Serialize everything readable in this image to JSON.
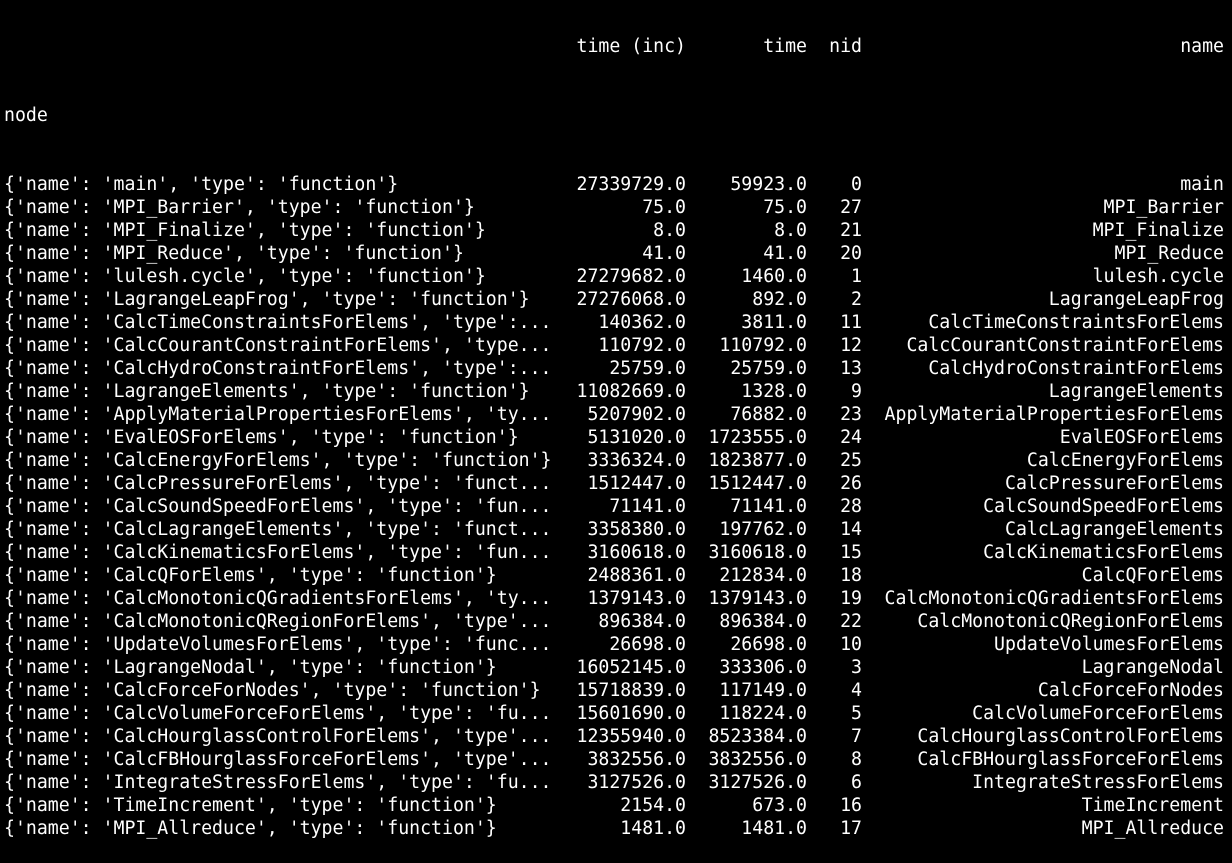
{
  "header": {
    "time_inc": "time (inc)",
    "time": "time",
    "nid": "nid",
    "name": "name",
    "index_label": "node"
  },
  "rows": [
    {
      "node": "{'name': 'main', 'type': 'function'}",
      "time_inc": "27339729.0",
      "time": "59923.0",
      "nid": "0",
      "name": "main"
    },
    {
      "node": "{'name': 'MPI_Barrier', 'type': 'function'}",
      "time_inc": "75.0",
      "time": "75.0",
      "nid": "27",
      "name": "MPI_Barrier"
    },
    {
      "node": "{'name': 'MPI_Finalize', 'type': 'function'}",
      "time_inc": "8.0",
      "time": "8.0",
      "nid": "21",
      "name": "MPI_Finalize"
    },
    {
      "node": "{'name': 'MPI_Reduce', 'type': 'function'}",
      "time_inc": "41.0",
      "time": "41.0",
      "nid": "20",
      "name": "MPI_Reduce"
    },
    {
      "node": "{'name': 'lulesh.cycle', 'type': 'function'}",
      "time_inc": "27279682.0",
      "time": "1460.0",
      "nid": "1",
      "name": "lulesh.cycle"
    },
    {
      "node": "{'name': 'LagrangeLeapFrog', 'type': 'function'}",
      "time_inc": "27276068.0",
      "time": "892.0",
      "nid": "2",
      "name": "LagrangeLeapFrog"
    },
    {
      "node": "{'name': 'CalcTimeConstraintsForElems', 'type':...",
      "time_inc": "140362.0",
      "time": "3811.0",
      "nid": "11",
      "name": "CalcTimeConstraintsForElems"
    },
    {
      "node": "{'name': 'CalcCourantConstraintForElems', 'type...",
      "time_inc": "110792.0",
      "time": "110792.0",
      "nid": "12",
      "name": "CalcCourantConstraintForElems"
    },
    {
      "node": "{'name': 'CalcHydroConstraintForElems', 'type':...",
      "time_inc": "25759.0",
      "time": "25759.0",
      "nid": "13",
      "name": "CalcHydroConstraintForElems"
    },
    {
      "node": "{'name': 'LagrangeElements', 'type': 'function'}",
      "time_inc": "11082669.0",
      "time": "1328.0",
      "nid": "9",
      "name": "LagrangeElements"
    },
    {
      "node": "{'name': 'ApplyMaterialPropertiesForElems', 'ty...",
      "time_inc": "5207902.0",
      "time": "76882.0",
      "nid": "23",
      "name": "ApplyMaterialPropertiesForElems"
    },
    {
      "node": "{'name': 'EvalEOSForElems', 'type': 'function'}",
      "time_inc": "5131020.0",
      "time": "1723555.0",
      "nid": "24",
      "name": "EvalEOSForElems"
    },
    {
      "node": "{'name': 'CalcEnergyForElems', 'type': 'function'}",
      "time_inc": "3336324.0",
      "time": "1823877.0",
      "nid": "25",
      "name": "CalcEnergyForElems"
    },
    {
      "node": "{'name': 'CalcPressureForElems', 'type': 'funct...",
      "time_inc": "1512447.0",
      "time": "1512447.0",
      "nid": "26",
      "name": "CalcPressureForElems"
    },
    {
      "node": "{'name': 'CalcSoundSpeedForElems', 'type': 'fun...",
      "time_inc": "71141.0",
      "time": "71141.0",
      "nid": "28",
      "name": "CalcSoundSpeedForElems"
    },
    {
      "node": "{'name': 'CalcLagrangeElements', 'type': 'funct...",
      "time_inc": "3358380.0",
      "time": "197762.0",
      "nid": "14",
      "name": "CalcLagrangeElements"
    },
    {
      "node": "{'name': 'CalcKinematicsForElems', 'type': 'fun...",
      "time_inc": "3160618.0",
      "time": "3160618.0",
      "nid": "15",
      "name": "CalcKinematicsForElems"
    },
    {
      "node": "{'name': 'CalcQForElems', 'type': 'function'}",
      "time_inc": "2488361.0",
      "time": "212834.0",
      "nid": "18",
      "name": "CalcQForElems"
    },
    {
      "node": "{'name': 'CalcMonotonicQGradientsForElems', 'ty...",
      "time_inc": "1379143.0",
      "time": "1379143.0",
      "nid": "19",
      "name": "CalcMonotonicQGradientsForElems"
    },
    {
      "node": "{'name': 'CalcMonotonicQRegionForElems', 'type'...",
      "time_inc": "896384.0",
      "time": "896384.0",
      "nid": "22",
      "name": "CalcMonotonicQRegionForElems"
    },
    {
      "node": "{'name': 'UpdateVolumesForElems', 'type': 'func...",
      "time_inc": "26698.0",
      "time": "26698.0",
      "nid": "10",
      "name": "UpdateVolumesForElems"
    },
    {
      "node": "{'name': 'LagrangeNodal', 'type': 'function'}",
      "time_inc": "16052145.0",
      "time": "333306.0",
      "nid": "3",
      "name": "LagrangeNodal"
    },
    {
      "node": "{'name': 'CalcForceForNodes', 'type': 'function'}",
      "time_inc": "15718839.0",
      "time": "117149.0",
      "nid": "4",
      "name": "CalcForceForNodes"
    },
    {
      "node": "{'name': 'CalcVolumeForceForElems', 'type': 'fu...",
      "time_inc": "15601690.0",
      "time": "118224.0",
      "nid": "5",
      "name": "CalcVolumeForceForElems"
    },
    {
      "node": "{'name': 'CalcHourglassControlForElems', 'type'...",
      "time_inc": "12355940.0",
      "time": "8523384.0",
      "nid": "7",
      "name": "CalcHourglassControlForElems"
    },
    {
      "node": "{'name': 'CalcFBHourglassForceForElems', 'type'...",
      "time_inc": "3832556.0",
      "time": "3832556.0",
      "nid": "8",
      "name": "CalcFBHourglassForceForElems"
    },
    {
      "node": "{'name': 'IntegrateStressForElems', 'type': 'fu...",
      "time_inc": "3127526.0",
      "time": "3127526.0",
      "nid": "6",
      "name": "IntegrateStressForElems"
    },
    {
      "node": "{'name': 'TimeIncrement', 'type': 'function'}",
      "time_inc": "2154.0",
      "time": "673.0",
      "nid": "16",
      "name": "TimeIncrement"
    },
    {
      "node": "{'name': 'MPI_Allreduce', 'type': 'function'}",
      "time_inc": "1481.0",
      "time": "1481.0",
      "nid": "17",
      "name": "MPI_Allreduce"
    }
  ]
}
